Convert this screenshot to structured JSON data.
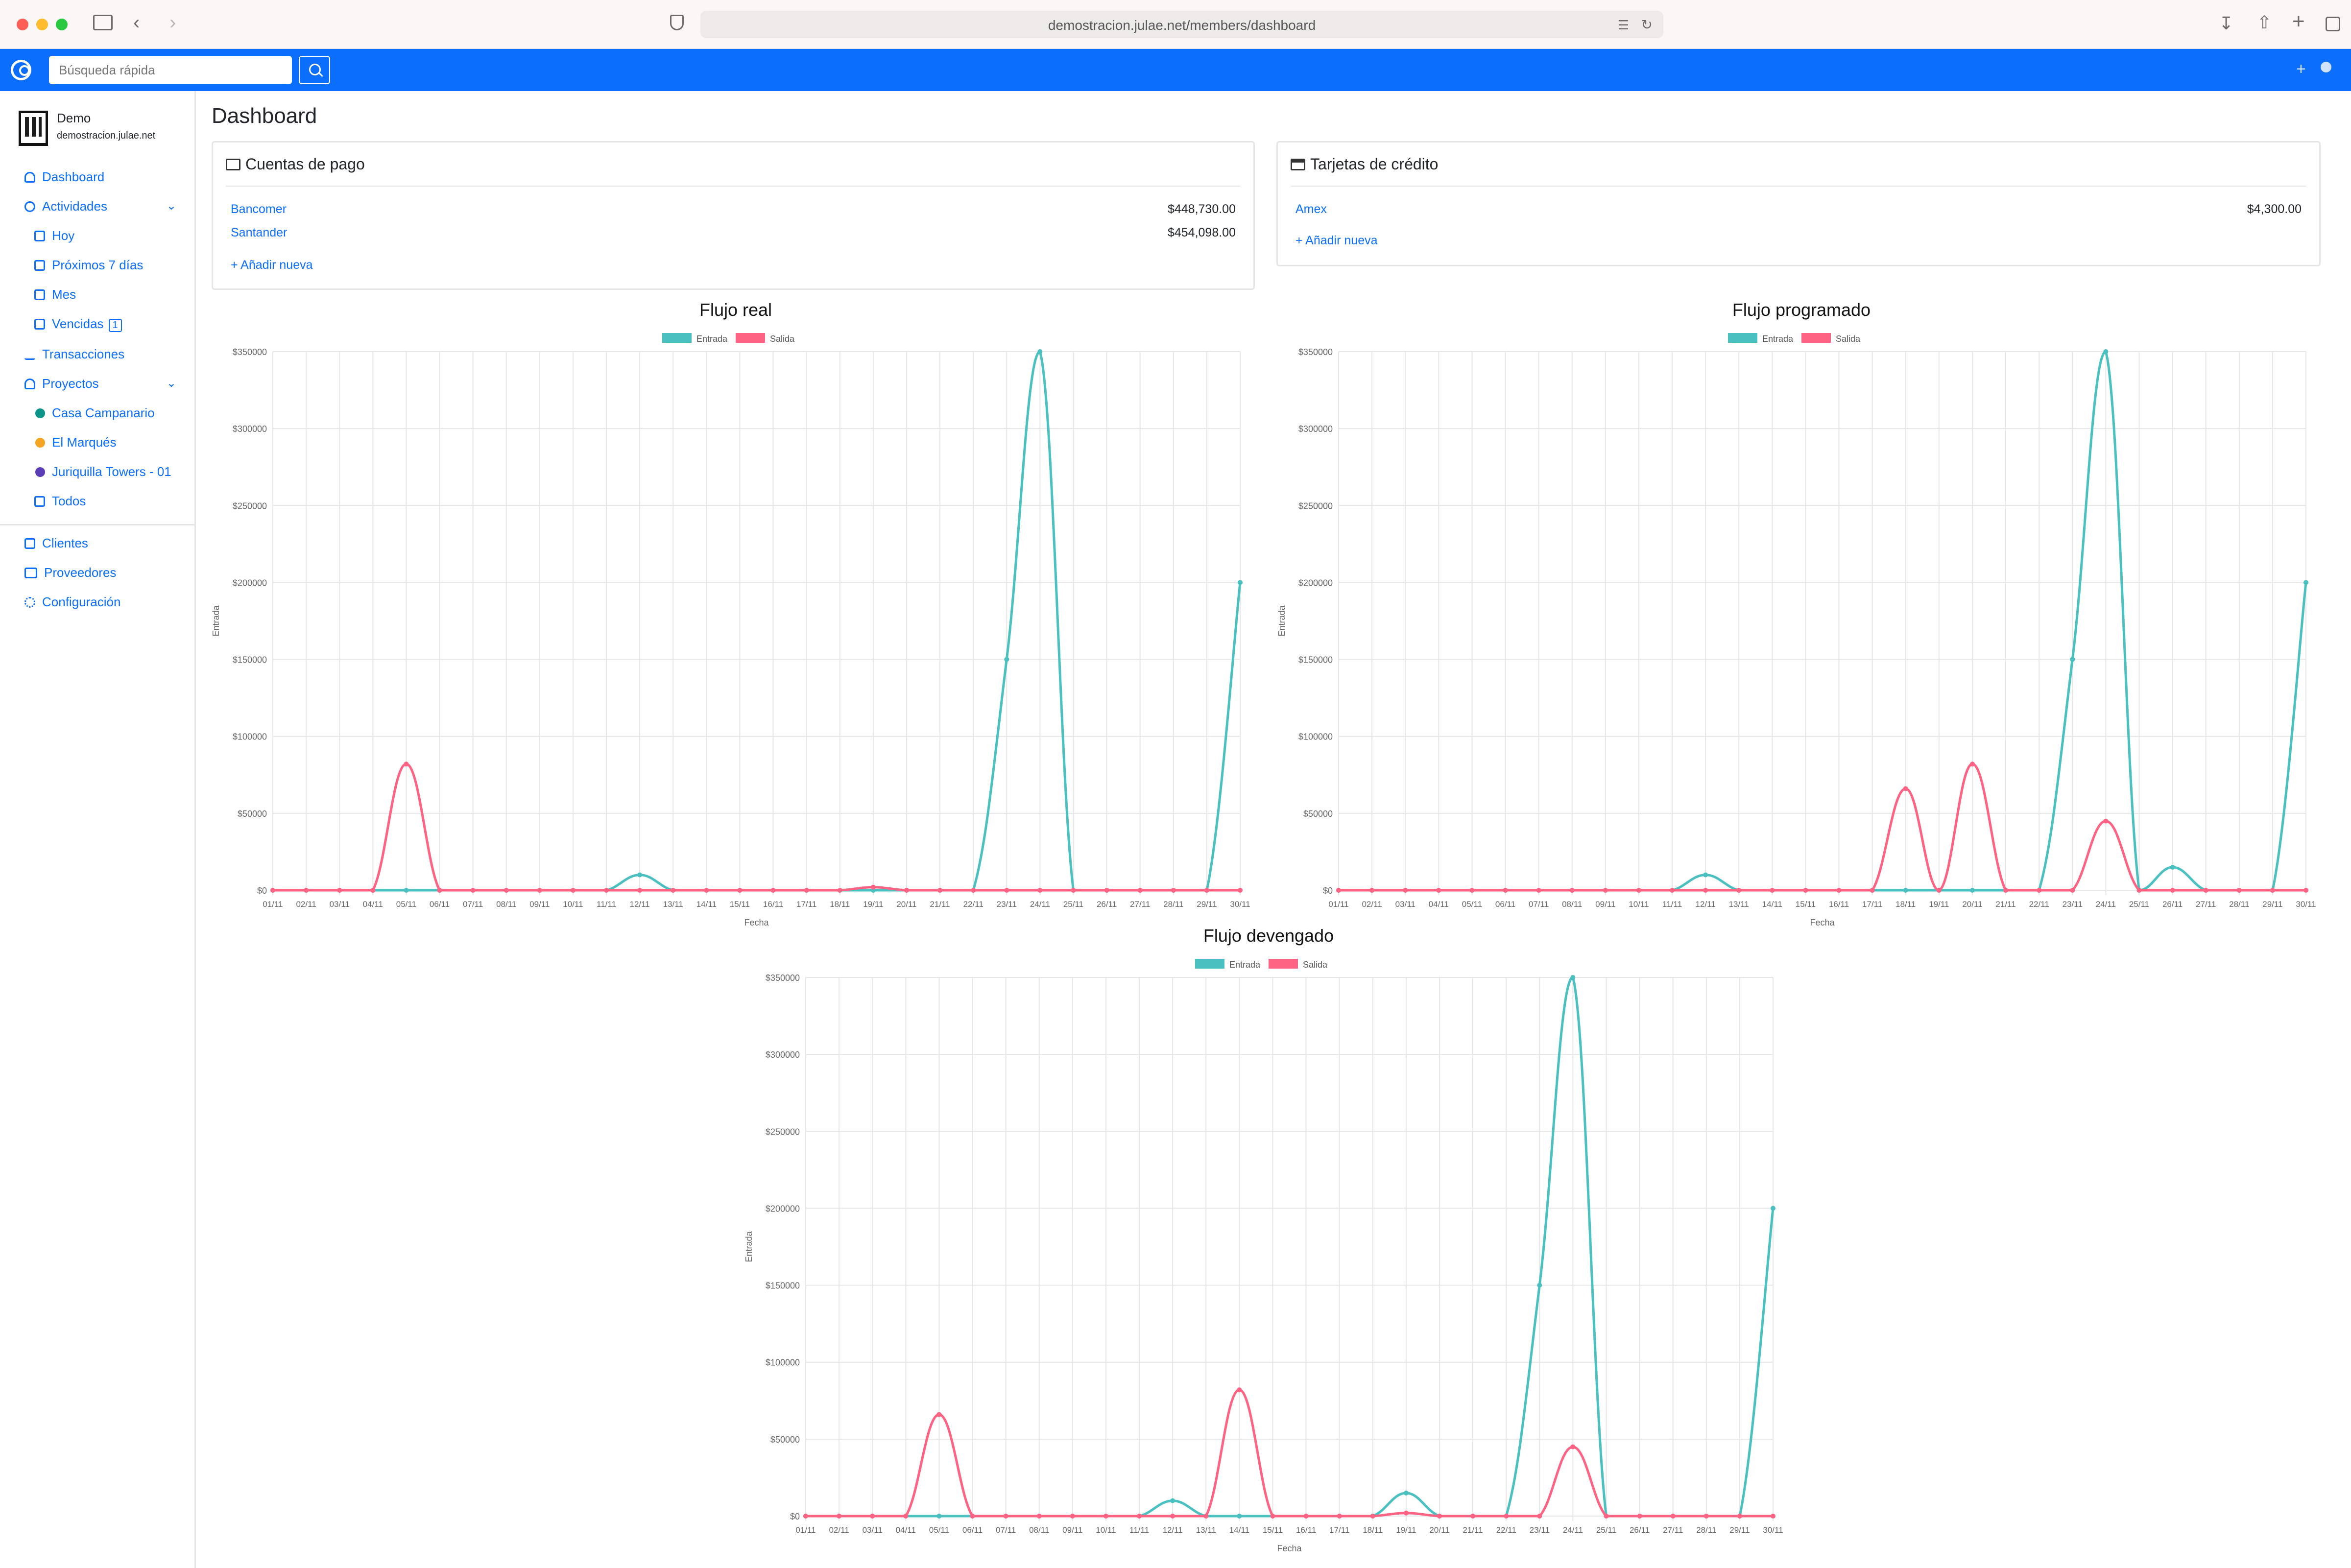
{
  "browser": {
    "url": "demostracion.julae.net/members/dashboard"
  },
  "topbar": {
    "search_placeholder": "Búsqueda rápida"
  },
  "sidebar": {
    "org_name": "Demo",
    "org_domain": "demostracion.julae.net",
    "items": [
      {
        "label": "Dashboard"
      },
      {
        "label": "Actividades"
      },
      {
        "label": "Hoy"
      },
      {
        "label": "Próximos 7 días"
      },
      {
        "label": "Mes"
      },
      {
        "label": "Vencidas",
        "badge": "1"
      },
      {
        "label": "Transacciones"
      },
      {
        "label": "Proyectos"
      },
      {
        "label": "Casa Campanario",
        "color": "#0d9488"
      },
      {
        "label": "El Marqués",
        "color": "#f5a524"
      },
      {
        "label": "Juriquilla Towers - 01",
        "color": "#5b3db5"
      },
      {
        "label": "Todos"
      },
      {
        "label": "Clientes"
      },
      {
        "label": "Proveedores"
      },
      {
        "label": "Configuración"
      }
    ]
  },
  "main": {
    "title": "Dashboard",
    "cuentas": {
      "title": "Cuentas de pago",
      "accounts": [
        {
          "name": "Bancomer",
          "amount": "$448,730.00"
        },
        {
          "name": "Santander",
          "amount": "$454,098.00"
        }
      ],
      "add_label": "Añadir nueva"
    },
    "tarjetas": {
      "title": "Tarjetas de crédito",
      "accounts": [
        {
          "name": "Amex",
          "amount": "$4,300.00"
        }
      ],
      "add_label": "Añadir nueva"
    }
  },
  "colors": {
    "entrada": "#4bc0c0",
    "salida": "#ff6384",
    "accent": "#0b6efd"
  },
  "chart_data": [
    {
      "type": "line",
      "title": "Flujo real",
      "xlabel": "Fecha",
      "ylabel": "Entrada",
      "ylim": [
        0,
        350000
      ],
      "yticks": [
        "$0",
        "$50000",
        "$100000",
        "$150000",
        "$200000",
        "$250000",
        "$300000",
        "$350000"
      ],
      "legend_position": "top",
      "categories": [
        "01/11",
        "02/11",
        "03/11",
        "04/11",
        "05/11",
        "06/11",
        "07/11",
        "08/11",
        "09/11",
        "10/11",
        "11/11",
        "12/11",
        "13/11",
        "14/11",
        "15/11",
        "16/11",
        "17/11",
        "18/11",
        "19/11",
        "20/11",
        "21/11",
        "22/11",
        "23/11",
        "24/11",
        "25/11",
        "26/11",
        "27/11",
        "28/11",
        "29/11",
        "30/11"
      ],
      "series": [
        {
          "name": "Entrada",
          "values": [
            0,
            0,
            0,
            0,
            0,
            0,
            0,
            0,
            0,
            0,
            0,
            10000,
            0,
            0,
            0,
            0,
            0,
            0,
            0,
            0,
            0,
            0,
            150000,
            350000,
            0,
            0,
            0,
            0,
            0,
            200000
          ]
        },
        {
          "name": "Salida",
          "values": [
            0,
            0,
            0,
            0,
            82000,
            0,
            0,
            0,
            0,
            0,
            0,
            0,
            0,
            0,
            0,
            0,
            0,
            0,
            2000,
            0,
            0,
            0,
            0,
            0,
            0,
            0,
            0,
            0,
            0,
            0
          ]
        }
      ]
    },
    {
      "type": "line",
      "title": "Flujo programado",
      "xlabel": "Fecha",
      "ylabel": "Entrada",
      "ylim": [
        0,
        350000
      ],
      "yticks": [
        "$0",
        "$50000",
        "$100000",
        "$150000",
        "$200000",
        "$250000",
        "$300000",
        "$350000"
      ],
      "legend_position": "top",
      "categories": [
        "01/11",
        "02/11",
        "03/11",
        "04/11",
        "05/11",
        "06/11",
        "07/11",
        "08/11",
        "09/11",
        "10/11",
        "11/11",
        "12/11",
        "13/11",
        "14/11",
        "15/11",
        "16/11",
        "17/11",
        "18/11",
        "19/11",
        "20/11",
        "21/11",
        "22/11",
        "23/11",
        "24/11",
        "25/11",
        "26/11",
        "27/11",
        "28/11",
        "29/11",
        "30/11"
      ],
      "series": [
        {
          "name": "Entrada",
          "values": [
            0,
            0,
            0,
            0,
            0,
            0,
            0,
            0,
            0,
            0,
            0,
            10000,
            0,
            0,
            0,
            0,
            0,
            0,
            0,
            0,
            0,
            0,
            150000,
            350000,
            0,
            15000,
            0,
            0,
            0,
            200000
          ]
        },
        {
          "name": "Salida",
          "values": [
            0,
            0,
            0,
            0,
            0,
            0,
            0,
            0,
            0,
            0,
            0,
            0,
            0,
            0,
            0,
            0,
            0,
            66000,
            0,
            82000,
            0,
            0,
            0,
            45000,
            0,
            0,
            0,
            0,
            0,
            0
          ]
        }
      ]
    },
    {
      "type": "line",
      "title": "Flujo devengado",
      "xlabel": "Fecha",
      "ylabel": "Entrada",
      "ylim": [
        0,
        350000
      ],
      "yticks": [
        "$0",
        "$50000",
        "$100000",
        "$150000",
        "$200000",
        "$250000",
        "$300000",
        "$350000"
      ],
      "legend_position": "top",
      "categories": [
        "01/11",
        "02/11",
        "03/11",
        "04/11",
        "05/11",
        "06/11",
        "07/11",
        "08/11",
        "09/11",
        "10/11",
        "11/11",
        "12/11",
        "13/11",
        "14/11",
        "15/11",
        "16/11",
        "17/11",
        "18/11",
        "19/11",
        "20/11",
        "21/11",
        "22/11",
        "23/11",
        "24/11",
        "25/11",
        "26/11",
        "27/11",
        "28/11",
        "29/11",
        "30/11"
      ],
      "series": [
        {
          "name": "Entrada",
          "values": [
            0,
            0,
            0,
            0,
            0,
            0,
            0,
            0,
            0,
            0,
            0,
            10000,
            0,
            0,
            0,
            0,
            0,
            0,
            15000,
            0,
            0,
            0,
            150000,
            350000,
            0,
            0,
            0,
            0,
            0,
            200000
          ]
        },
        {
          "name": "Salida",
          "values": [
            0,
            0,
            0,
            0,
            66000,
            0,
            0,
            0,
            0,
            0,
            0,
            0,
            0,
            82000,
            0,
            0,
            0,
            0,
            2000,
            0,
            0,
            0,
            0,
            45000,
            0,
            0,
            0,
            0,
            0,
            0
          ]
        }
      ]
    }
  ]
}
